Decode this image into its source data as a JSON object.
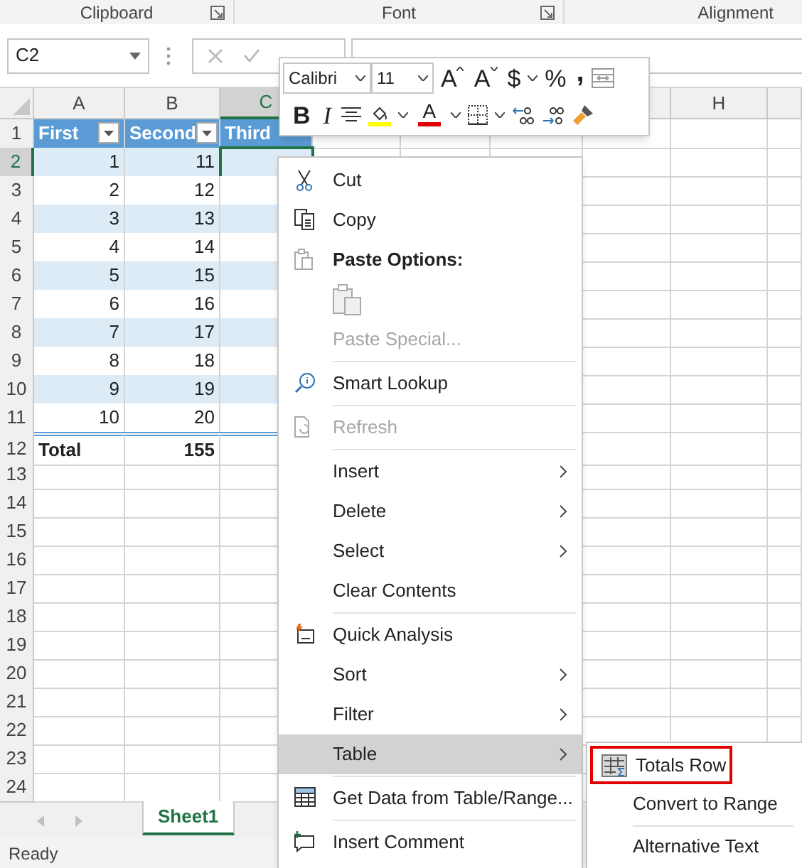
{
  "ribbon_groups": [
    {
      "label": "Clipboard",
      "launcher": true
    },
    {
      "label": "Font",
      "launcher": true
    },
    {
      "label": "Alignment",
      "launcher": false
    }
  ],
  "name_box": {
    "value": "C2"
  },
  "mini_toolbar": {
    "font": "Calibri",
    "size": "11",
    "grow": "A",
    "shrink": "A",
    "currency": "$",
    "percent": "%",
    "comma": ",",
    "bold": "B",
    "italic": "I",
    "font_color": "A"
  },
  "columns": [
    {
      "label": "A",
      "selected": false
    },
    {
      "label": "B",
      "selected": false
    },
    {
      "label": "C",
      "selected": true
    },
    {
      "label": "H",
      "selected": false
    }
  ],
  "row_numbers": [
    {
      "label": "1",
      "selected": false
    },
    {
      "label": "2",
      "selected": true
    },
    {
      "label": "3",
      "selected": false
    },
    {
      "label": "4",
      "selected": false
    },
    {
      "label": "5",
      "selected": false
    },
    {
      "label": "6",
      "selected": false
    },
    {
      "label": "7",
      "selected": false
    },
    {
      "label": "8",
      "selected": false
    },
    {
      "label": "9",
      "selected": false
    },
    {
      "label": "10",
      "selected": false
    },
    {
      "label": "11",
      "selected": false
    },
    {
      "label": "12",
      "selected": false
    },
    {
      "label": "13",
      "selected": false
    },
    {
      "label": "14",
      "selected": false
    },
    {
      "label": "15",
      "selected": false
    },
    {
      "label": "16",
      "selected": false
    },
    {
      "label": "17",
      "selected": false
    },
    {
      "label": "18",
      "selected": false
    },
    {
      "label": "19",
      "selected": false
    },
    {
      "label": "20",
      "selected": false
    },
    {
      "label": "21",
      "selected": false
    },
    {
      "label": "22",
      "selected": false
    },
    {
      "label": "23",
      "selected": false
    },
    {
      "label": "24",
      "selected": false
    }
  ],
  "table": {
    "headers": [
      {
        "label": "First",
        "filter": true
      },
      {
        "label": "Second",
        "filter": true
      },
      {
        "label": "Third",
        "filter": false
      }
    ],
    "rows": [
      [
        "1",
        "11"
      ],
      [
        "2",
        "12"
      ],
      [
        "3",
        "13"
      ],
      [
        "4",
        "14"
      ],
      [
        "5",
        "15"
      ],
      [
        "6",
        "16"
      ],
      [
        "7",
        "17"
      ],
      [
        "8",
        "18"
      ],
      [
        "9",
        "19"
      ],
      [
        "10",
        "20"
      ]
    ],
    "total": {
      "label": "Total",
      "value": "155"
    }
  },
  "context_menu": [
    {
      "kind": "item",
      "label": "Cut",
      "disabled": false,
      "submenu": false,
      "selected": false,
      "separator_before": false
    },
    {
      "kind": "item",
      "label": "Copy",
      "disabled": false,
      "submenu": false,
      "selected": false,
      "separator_before": false
    },
    {
      "kind": "header",
      "label": "Paste Options:",
      "separator_before": false
    },
    {
      "kind": "paste_icons",
      "separator_before": false
    },
    {
      "kind": "item",
      "label": "Paste Special...",
      "disabled": true,
      "submenu": false,
      "selected": false,
      "separator_before": false
    },
    {
      "kind": "item",
      "label": "Smart Lookup",
      "disabled": false,
      "submenu": false,
      "selected": false,
      "separator_before": true
    },
    {
      "kind": "item",
      "label": "Refresh",
      "disabled": true,
      "submenu": false,
      "selected": false,
      "separator_before": true
    },
    {
      "kind": "item",
      "label": "Insert",
      "disabled": false,
      "submenu": true,
      "selected": false,
      "separator_before": true
    },
    {
      "kind": "item",
      "label": "Delete",
      "disabled": false,
      "submenu": true,
      "selected": false,
      "separator_before": false
    },
    {
      "kind": "item",
      "label": "Select",
      "disabled": false,
      "submenu": true,
      "selected": false,
      "separator_before": false
    },
    {
      "kind": "item",
      "label": "Clear Contents",
      "disabled": false,
      "submenu": false,
      "selected": false,
      "separator_before": false
    },
    {
      "kind": "item",
      "label": "Quick Analysis",
      "disabled": false,
      "submenu": false,
      "selected": false,
      "separator_before": true
    },
    {
      "kind": "item",
      "label": "Sort",
      "disabled": false,
      "submenu": true,
      "selected": false,
      "separator_before": false
    },
    {
      "kind": "item",
      "label": "Filter",
      "disabled": false,
      "submenu": true,
      "selected": false,
      "separator_before": false
    },
    {
      "kind": "item",
      "label": "Table",
      "disabled": false,
      "submenu": true,
      "selected": true,
      "separator_before": false
    },
    {
      "kind": "item",
      "label": "Get Data from Table/Range...",
      "disabled": false,
      "submenu": false,
      "selected": false,
      "separator_before": true
    },
    {
      "kind": "item",
      "label": "Insert Comment",
      "disabled": false,
      "submenu": false,
      "selected": false,
      "separator_before": true
    }
  ],
  "submenu": [
    {
      "label": "Totals Row",
      "outlined": true,
      "separator_before": false
    },
    {
      "label": "Convert to Range",
      "outlined": false,
      "separator_before": false
    },
    {
      "label": "Alternative Text",
      "outlined": false,
      "separator_before": true
    }
  ],
  "sheet_tabs": [
    {
      "label": "Sheet1",
      "selected": true
    }
  ],
  "status_bar": {
    "text": "Ready"
  }
}
